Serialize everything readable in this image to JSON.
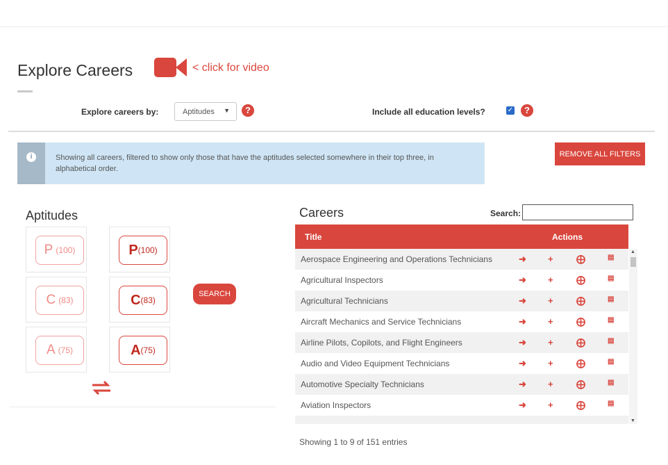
{
  "header": {
    "page_title": "Explore Careers",
    "video_link": "< click for video",
    "explore_by_label": "Explore careers by:",
    "explore_by_selected": "Aptitudes",
    "include_levels_label": "Include all education levels?",
    "include_levels_checked": true
  },
  "info": {
    "message": "Showing all careers, filtered to show only those that have the aptitudes selected somewhere in their top three, in alphabetical order.",
    "icon": "info-icon"
  },
  "remove_filters_label": "REMOVE ALL FILTERS",
  "aptitudes": {
    "title": "Aptitudes",
    "items": [
      {
        "letter": "P",
        "count": "(100)"
      },
      {
        "letter": "C",
        "count": "(83)"
      },
      {
        "letter": "A",
        "count": "(75)"
      }
    ],
    "search_label": "SEARCH"
  },
  "careers": {
    "title": "Careers",
    "search_label": "Search:",
    "search_value": "",
    "columns": [
      "Title",
      "Actions"
    ],
    "rows": [
      "Aerospace Engineering and Operations Technicians",
      "Agricultural Inspectors",
      "Agricultural Technicians",
      "Aircraft Mechanics and Service Technicians",
      "Airline Pilots, Copilots, and Flight Engineers",
      "Audio and Video Equipment Technicians",
      "Automotive Specialty Technicians",
      "Aviation Inspectors"
    ],
    "action_icons": [
      "arrow-right-icon",
      "plus-icon",
      "lifebuoy-icon",
      "bar-chart-icon"
    ],
    "footer": "Showing 1 to 9 of 151 entries"
  },
  "colors": {
    "accent": "#d9463d",
    "info_bg": "#cfe5f5"
  }
}
